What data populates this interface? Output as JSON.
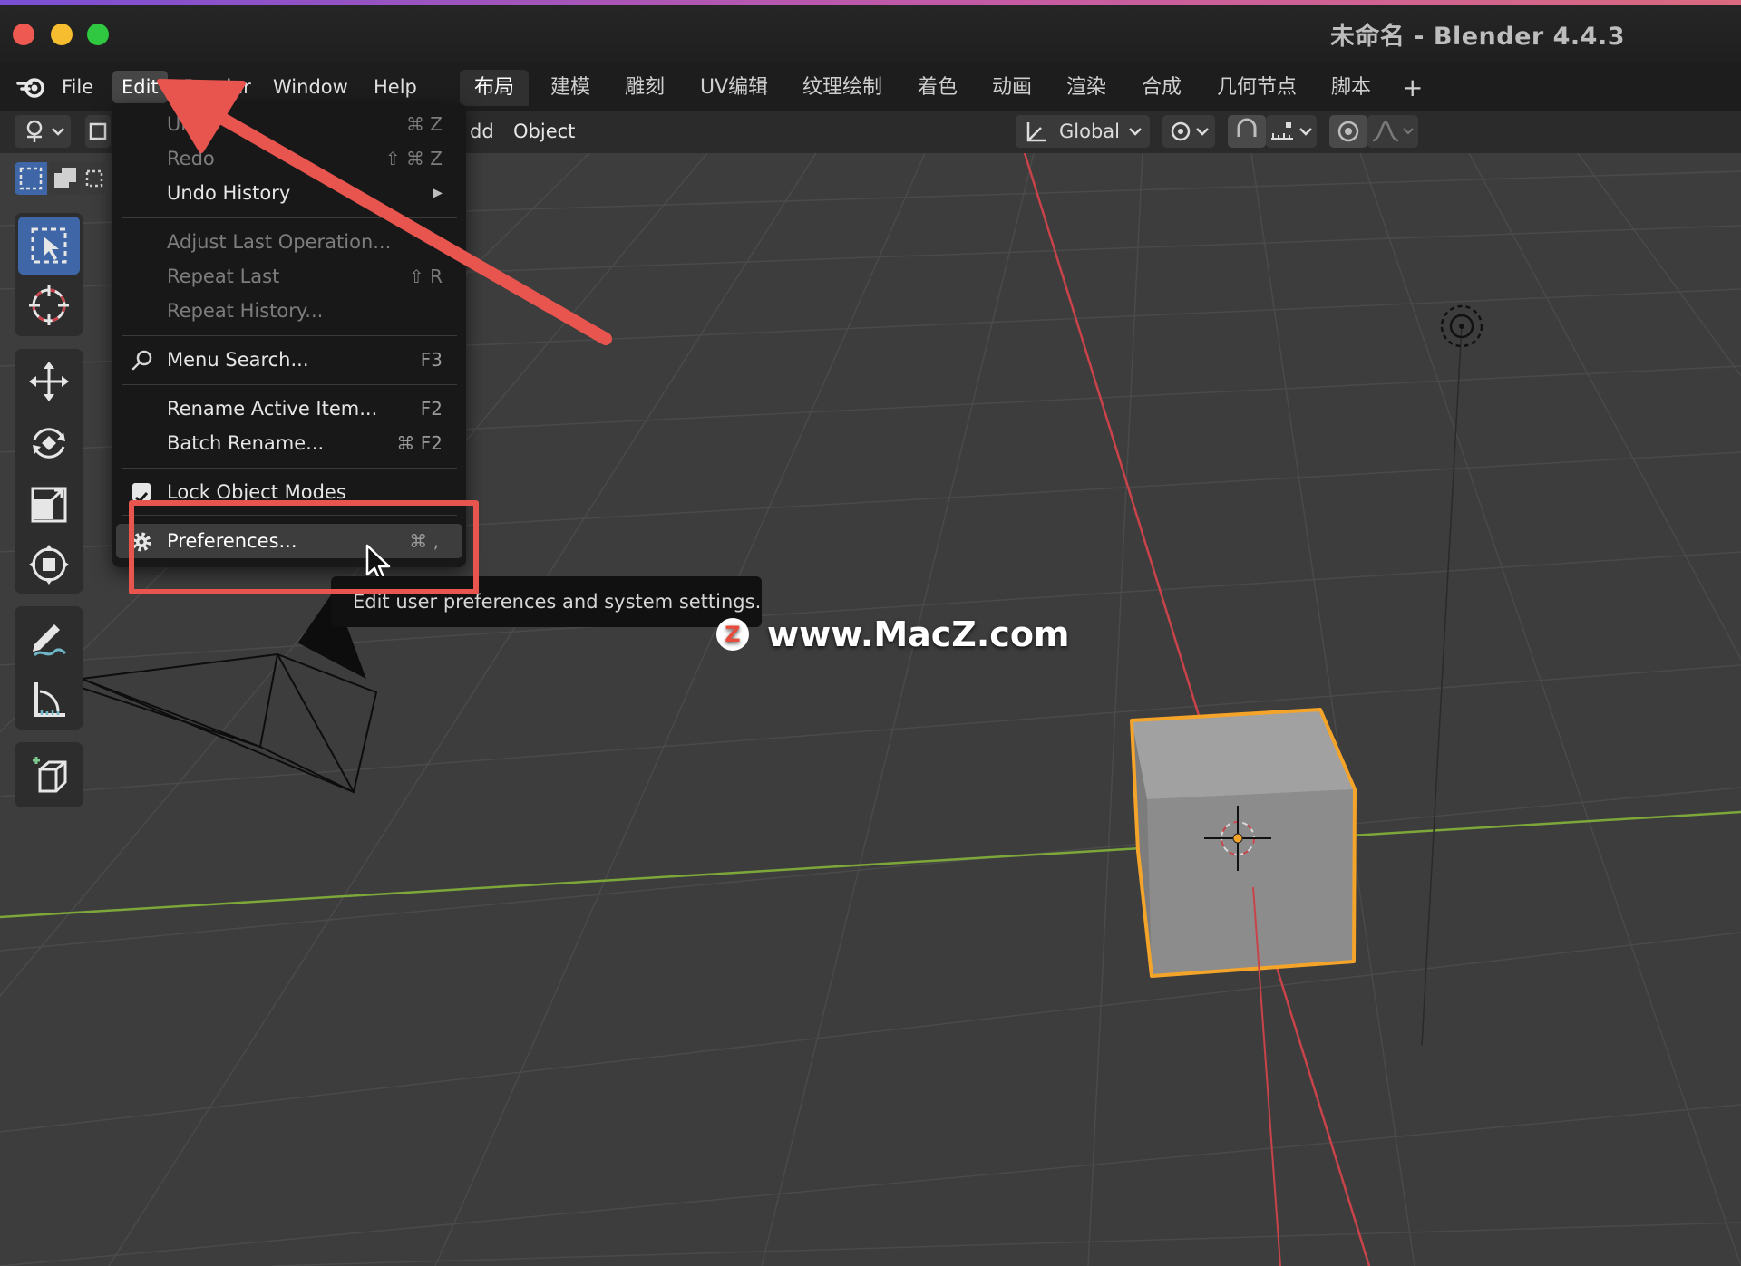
{
  "window": {
    "title": "未命名 - Blender 4.4.3",
    "traffic_colors": [
      "#ee5a52",
      "#f5bd2f",
      "#2fc840"
    ]
  },
  "menubar": {
    "items": [
      "File",
      "Edit",
      "Render",
      "Window",
      "Help"
    ],
    "active": "Edit"
  },
  "workspaces": {
    "tabs": [
      "布局",
      "建模",
      "雕刻",
      "UV编辑",
      "纹理绘制",
      "着色",
      "动画",
      "渲染",
      "合成",
      "几何节点",
      "脚本"
    ],
    "active": "布局",
    "add_label": "+"
  },
  "viewport_header": {
    "add_label": "dd",
    "object_label": "Object",
    "transform_orientation": "Global"
  },
  "edit_menu": {
    "items": [
      {
        "label": "Undo",
        "shortcut": "⌘ Z",
        "enabled": false
      },
      {
        "label": "Redo",
        "shortcut": "⇧ ⌘ Z",
        "enabled": false
      },
      {
        "label": "Undo History",
        "shortcut": "▶",
        "enabled": true
      },
      {
        "label": "Adjust Last Operation...",
        "shortcut": "",
        "enabled": false
      },
      {
        "label": "Repeat Last",
        "shortcut": "⇧ R",
        "enabled": false
      },
      {
        "label": "Repeat History...",
        "shortcut": "",
        "enabled": false
      },
      {
        "label": "Menu Search...",
        "shortcut": "F3",
        "enabled": true
      },
      {
        "label": "Rename Active Item...",
        "shortcut": "F2",
        "enabled": true
      },
      {
        "label": "Batch Rename...",
        "shortcut": "⌘ F2",
        "enabled": true
      },
      {
        "label": "Lock Object Modes",
        "shortcut": "",
        "enabled": true,
        "checked": true
      },
      {
        "label": "Preferences...",
        "shortcut": "⌘ ,",
        "enabled": true,
        "highlighted": true
      }
    ]
  },
  "tooltip": {
    "text": "Edit user preferences and system settings."
  },
  "watermark": {
    "logo": "Z",
    "text": "www.MacZ.com"
  },
  "colors": {
    "annotation_red": "#e8544e",
    "selection_orange": "#f5a42a",
    "x_axis": "#c8434a",
    "y_axis": "#7ea73a",
    "tool_active": "#3f67a8"
  }
}
